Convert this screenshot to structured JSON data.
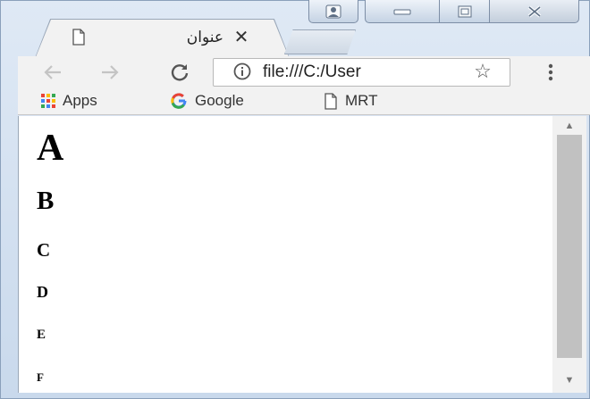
{
  "window": {
    "profile_icon": "person-icon",
    "minimize_icon": "minimize-icon",
    "maximize_icon": "maximize-icon",
    "close_icon": "close-icon"
  },
  "tab": {
    "title": "عنوان",
    "icon": "page-icon",
    "close_label": "✕"
  },
  "toolbar": {
    "back_icon": "back-arrow-icon",
    "forward_icon": "forward-arrow-icon",
    "reload_icon": "reload-icon",
    "info_icon": "info-icon",
    "url": "file:///C:/User",
    "star_label": "☆",
    "menu_icon": "kebab-menu-icon"
  },
  "bookmarks": [
    {
      "label": "Apps",
      "icon": "apps-grid-icon"
    },
    {
      "label": "Google",
      "icon": "google-icon"
    },
    {
      "label": "MRT",
      "icon": "page-icon"
    }
  ],
  "page": {
    "headings": [
      "A",
      "B",
      "C",
      "D",
      "E",
      "F"
    ]
  },
  "colors": {
    "frame": "#c9d9ec",
    "toolbar": "#f2f2f2",
    "scrollbar_thumb": "#c1c1c1",
    "google_blue": "#4285f4",
    "google_red": "#ea4335",
    "google_yellow": "#fbbc05",
    "google_green": "#34a853"
  }
}
